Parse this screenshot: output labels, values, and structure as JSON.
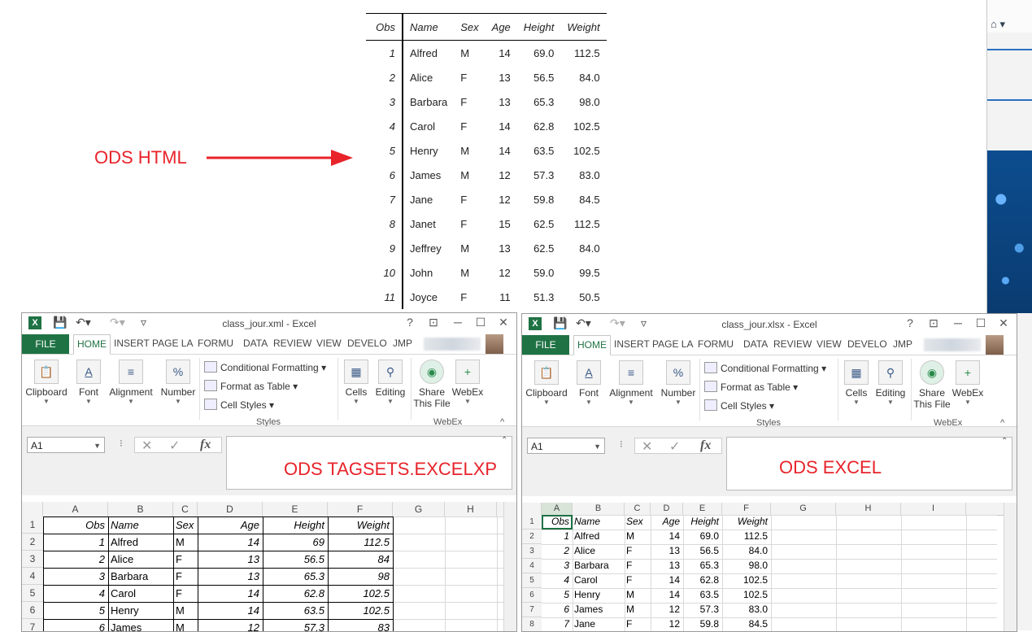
{
  "ods_html": {
    "headers": [
      "Obs",
      "Name",
      "Sex",
      "Age",
      "Height",
      "Weight"
    ],
    "rows": [
      [
        "1",
        "Alfred",
        "M",
        "14",
        "69.0",
        "112.5"
      ],
      [
        "2",
        "Alice",
        "F",
        "13",
        "56.5",
        "84.0"
      ],
      [
        "3",
        "Barbara",
        "F",
        "13",
        "65.3",
        "98.0"
      ],
      [
        "4",
        "Carol",
        "F",
        "14",
        "62.8",
        "102.5"
      ],
      [
        "5",
        "Henry",
        "M",
        "14",
        "63.5",
        "102.5"
      ],
      [
        "6",
        "James",
        "M",
        "12",
        "57.3",
        "83.0"
      ],
      [
        "7",
        "Jane",
        "F",
        "12",
        "59.8",
        "84.5"
      ],
      [
        "8",
        "Janet",
        "F",
        "15",
        "62.5",
        "112.5"
      ],
      [
        "9",
        "Jeffrey",
        "M",
        "13",
        "62.5",
        "84.0"
      ],
      [
        "10",
        "John",
        "M",
        "12",
        "59.0",
        "99.5"
      ],
      [
        "11",
        "Joyce",
        "F",
        "11",
        "51.3",
        "50.5"
      ]
    ]
  },
  "labels": {
    "ods_html": "ODS HTML",
    "tagsets": "ODS TAGSETS.EXCELXP",
    "excel": "ODS EXCEL"
  },
  "arrow_color": "#e8232a",
  "excel_left": {
    "title": "class_jour.xml - Excel",
    "tabs": [
      "FILE",
      "HOME",
      "INSERT",
      "PAGE LA",
      "FORMU",
      "DATA",
      "REVIEW",
      "VIEW",
      "DEVELO",
      "JMP"
    ],
    "ribbon": {
      "clipboard": "Clipboard",
      "font": "Font",
      "alignment": "Alignment",
      "number": "Number",
      "cond_fmt": "Conditional Formatting",
      "fmt_table": "Format as Table",
      "cell_styles": "Cell Styles",
      "styles_group": "Styles",
      "cells": "Cells",
      "editing": "Editing",
      "share1": "Share",
      "share2": "This File",
      "webex": "WebEx",
      "webex_group": "WebEx"
    },
    "name_box": "A1",
    "columns": [
      "A",
      "B",
      "C",
      "D",
      "E",
      "F",
      "G",
      "H"
    ],
    "row_numbers": [
      "1",
      "2",
      "3",
      "4",
      "5",
      "6",
      "7"
    ],
    "headers": [
      "Obs",
      "Name",
      "Sex",
      "Age",
      "Height",
      "Weight"
    ],
    "rows": [
      [
        "1",
        "Alfred",
        "M",
        "14",
        "69",
        "112.5"
      ],
      [
        "2",
        "Alice",
        "F",
        "13",
        "56.5",
        "84"
      ],
      [
        "3",
        "Barbara",
        "F",
        "13",
        "65.3",
        "98"
      ],
      [
        "4",
        "Carol",
        "F",
        "14",
        "62.8",
        "102.5"
      ],
      [
        "5",
        "Henry",
        "M",
        "14",
        "63.5",
        "102.5"
      ],
      [
        "6",
        "James",
        "M",
        "12",
        "57.3",
        "83"
      ]
    ]
  },
  "excel_right": {
    "title": "class_jour.xlsx - Excel",
    "tabs": [
      "FILE",
      "HOME",
      "INSERT",
      "PAGE LA",
      "FORMU",
      "DATA",
      "REVIEW",
      "VIEW",
      "DEVELO",
      "JMP"
    ],
    "ribbon": {
      "clipboard": "Clipboard",
      "font": "Font",
      "alignment": "Alignment",
      "number": "Number",
      "cond_fmt": "Conditional Formatting",
      "fmt_table": "Format as Table",
      "cell_styles": "Cell Styles",
      "styles_group": "Styles",
      "cells": "Cells",
      "editing": "Editing",
      "share1": "Share",
      "share2": "This File",
      "webex": "WebEx",
      "webex_group": "WebEx"
    },
    "name_box": "A1",
    "columns": [
      "A",
      "B",
      "C",
      "D",
      "E",
      "F",
      "G",
      "H",
      "I"
    ],
    "row_numbers": [
      "1",
      "2",
      "3",
      "4",
      "5",
      "6",
      "7",
      "8"
    ],
    "headers": [
      "Obs",
      "Name",
      "Sex",
      "Age",
      "Height",
      "Weight"
    ],
    "rows": [
      [
        "1",
        "Alfred",
        "M",
        "14",
        "69.0",
        "112.5"
      ],
      [
        "2",
        "Alice",
        "F",
        "13",
        "56.5",
        "84.0"
      ],
      [
        "3",
        "Barbara",
        "F",
        "13",
        "65.3",
        "98.0"
      ],
      [
        "4",
        "Carol",
        "F",
        "14",
        "62.8",
        "102.5"
      ],
      [
        "5",
        "Henry",
        "M",
        "14",
        "63.5",
        "102.5"
      ],
      [
        "6",
        "James",
        "M",
        "12",
        "57.3",
        "83.0"
      ],
      [
        "7",
        "Jane",
        "F",
        "12",
        "59.8",
        "84.5"
      ]
    ]
  },
  "colors": {
    "excel_green": "#1f7244",
    "label_red": "#e8232a"
  }
}
